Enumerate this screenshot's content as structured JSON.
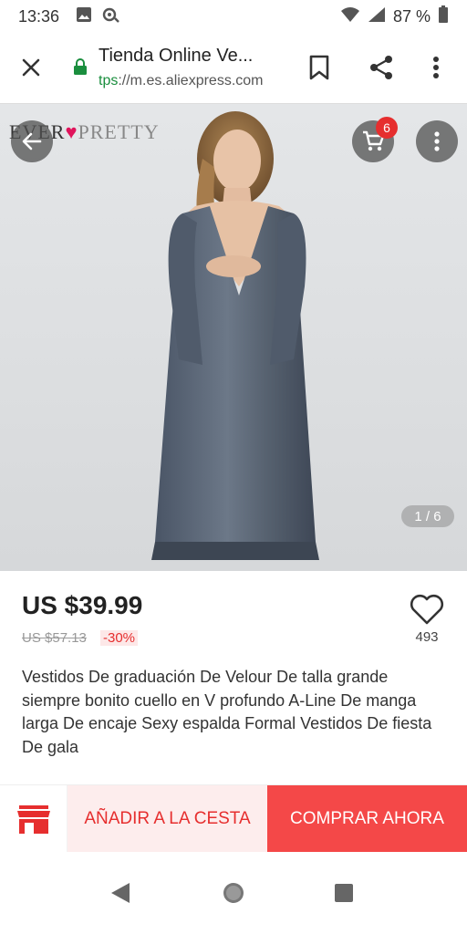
{
  "status_bar": {
    "time": "13:36",
    "battery": "87 %"
  },
  "browser": {
    "title": "Tienda Online Ve...",
    "url_scheme": "tps",
    "url_rest": "://m.es.aliexpress.com"
  },
  "hero": {
    "brand_logo_part1": "EVER",
    "brand_logo_part2": "PRETTY",
    "cart_count": "6",
    "image_counter": "1 / 6"
  },
  "product": {
    "price": "US $39.99",
    "original_price": "US $57.13",
    "discount": "-30%",
    "wishlist_count": "493",
    "title": "Vestidos De graduación De Velour De talla grande siempre bonito cuello en V profundo A-Line De manga larga De encaje Sexy espalda Formal Vestidos De fiesta De gala"
  },
  "actions": {
    "add_to_cart": "AÑADIR A LA CESTA",
    "buy_now": "COMPRAR AHORA"
  },
  "colors": {
    "accent_red": "#e62e2e",
    "buy_button": "#f44848",
    "add_cart_bg": "#fdeded",
    "secure_green": "#1a8e3e"
  },
  "icons": [
    "image-icon",
    "sync-icon",
    "wifi-icon",
    "signal-icon",
    "battery-icon",
    "close-icon",
    "lock-icon",
    "bookmark-icon",
    "share-icon",
    "more-vert-icon",
    "arrow-back-icon",
    "cart-icon",
    "heart-icon",
    "store-icon",
    "nav-back-icon",
    "nav-home-icon",
    "nav-recent-icon"
  ]
}
